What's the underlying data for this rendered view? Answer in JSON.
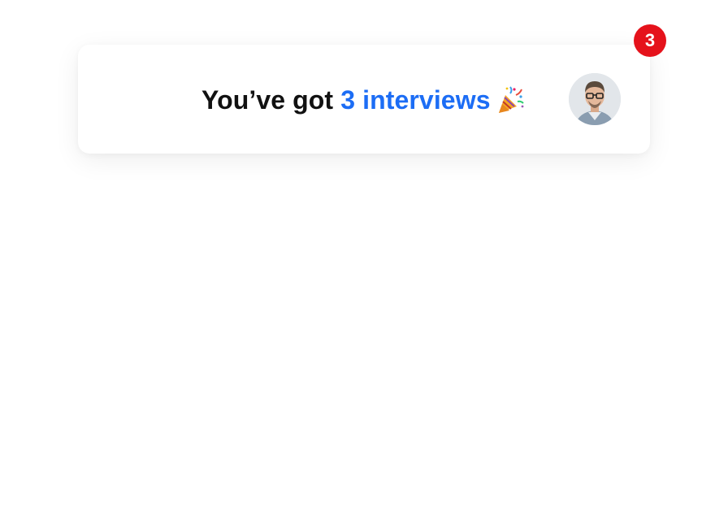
{
  "notification": {
    "text_prefix": "You’ve got",
    "text_highlight": "3 interviews",
    "emoji_icon": "party-popper-icon",
    "badge_count": "3",
    "colors": {
      "highlight": "#1c6df5",
      "badge": "#e5121b",
      "text": "#111111"
    }
  }
}
